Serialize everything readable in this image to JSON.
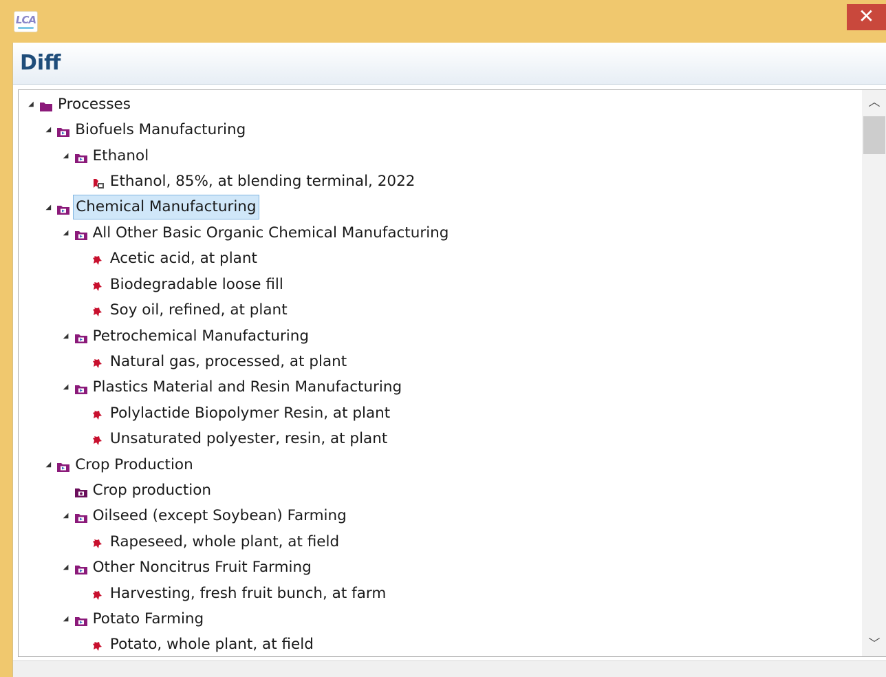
{
  "window": {
    "app_icon": "lca-logo",
    "app_icon_text": "LCA",
    "close_label": "✕"
  },
  "header": {
    "title": "Diff"
  },
  "tree": {
    "rows": [
      {
        "label": "Processes",
        "level": 0,
        "icon": "folder-icon",
        "expanded": true
      },
      {
        "label": "Biofuels Manufacturing",
        "level": 1,
        "icon": "category-folder-icon",
        "expanded": true
      },
      {
        "label": "Ethanol",
        "level": 2,
        "icon": "category-folder-icon",
        "expanded": true
      },
      {
        "label": "Ethanol, 85%, at blending terminal, 2022",
        "level": 3,
        "icon": "system-process-icon",
        "expanded": null
      },
      {
        "label": "Chemical Manufacturing",
        "level": 1,
        "icon": "category-folder-icon",
        "expanded": true,
        "selected": true
      },
      {
        "label": "All Other Basic Organic Chemical Manufacturing",
        "level": 2,
        "icon": "category-folder-icon",
        "expanded": true
      },
      {
        "label": "Acetic acid, at plant",
        "level": 3,
        "icon": "process-icon",
        "expanded": null
      },
      {
        "label": "Biodegradable loose fill",
        "level": 3,
        "icon": "process-icon",
        "expanded": null
      },
      {
        "label": "Soy oil, refined, at plant",
        "level": 3,
        "icon": "process-icon",
        "expanded": null
      },
      {
        "label": "Petrochemical Manufacturing",
        "level": 2,
        "icon": "category-folder-icon",
        "expanded": true
      },
      {
        "label": "Natural gas, processed, at plant",
        "level": 3,
        "icon": "process-icon",
        "expanded": null
      },
      {
        "label": "Plastics Material and Resin Manufacturing",
        "level": 2,
        "icon": "category-folder-icon",
        "expanded": true
      },
      {
        "label": "Polylactide Biopolymer Resin, at plant",
        "level": 3,
        "icon": "process-icon",
        "expanded": null
      },
      {
        "label": "Unsaturated polyester, resin, at plant",
        "level": 3,
        "icon": "process-icon",
        "expanded": null
      },
      {
        "label": "Crop Production",
        "level": 1,
        "icon": "category-folder-icon",
        "expanded": true
      },
      {
        "label": "Crop production",
        "level": 2,
        "icon": "category-folder-alt-icon",
        "expanded": null
      },
      {
        "label": "Oilseed (except Soybean) Farming",
        "level": 2,
        "icon": "category-folder-icon",
        "expanded": true
      },
      {
        "label": "Rapeseed, whole plant, at field",
        "level": 3,
        "icon": "process-icon",
        "expanded": null
      },
      {
        "label": "Other Noncitrus Fruit Farming",
        "level": 2,
        "icon": "category-folder-icon",
        "expanded": true
      },
      {
        "label": "Harvesting, fresh fruit bunch, at farm",
        "level": 3,
        "icon": "process-icon",
        "expanded": null
      },
      {
        "label": "Potato Farming",
        "level": 2,
        "icon": "category-folder-icon",
        "expanded": true
      },
      {
        "label": "Potato, whole plant, at field",
        "level": 3,
        "icon": "process-icon",
        "expanded": null
      }
    ]
  },
  "scrollbar": {
    "up_icon": "chevron-up-icon",
    "down_icon": "chevron-down-icon",
    "up_glyph": "︿",
    "down_glyph": "﹀"
  },
  "colors": {
    "title_bar": "#f0c86e",
    "close_button": "#c9483c",
    "header_title": "#1f4d7a",
    "folder": "#8b1a7a",
    "process": "#c8102e",
    "selection": "#d0e7f9"
  }
}
